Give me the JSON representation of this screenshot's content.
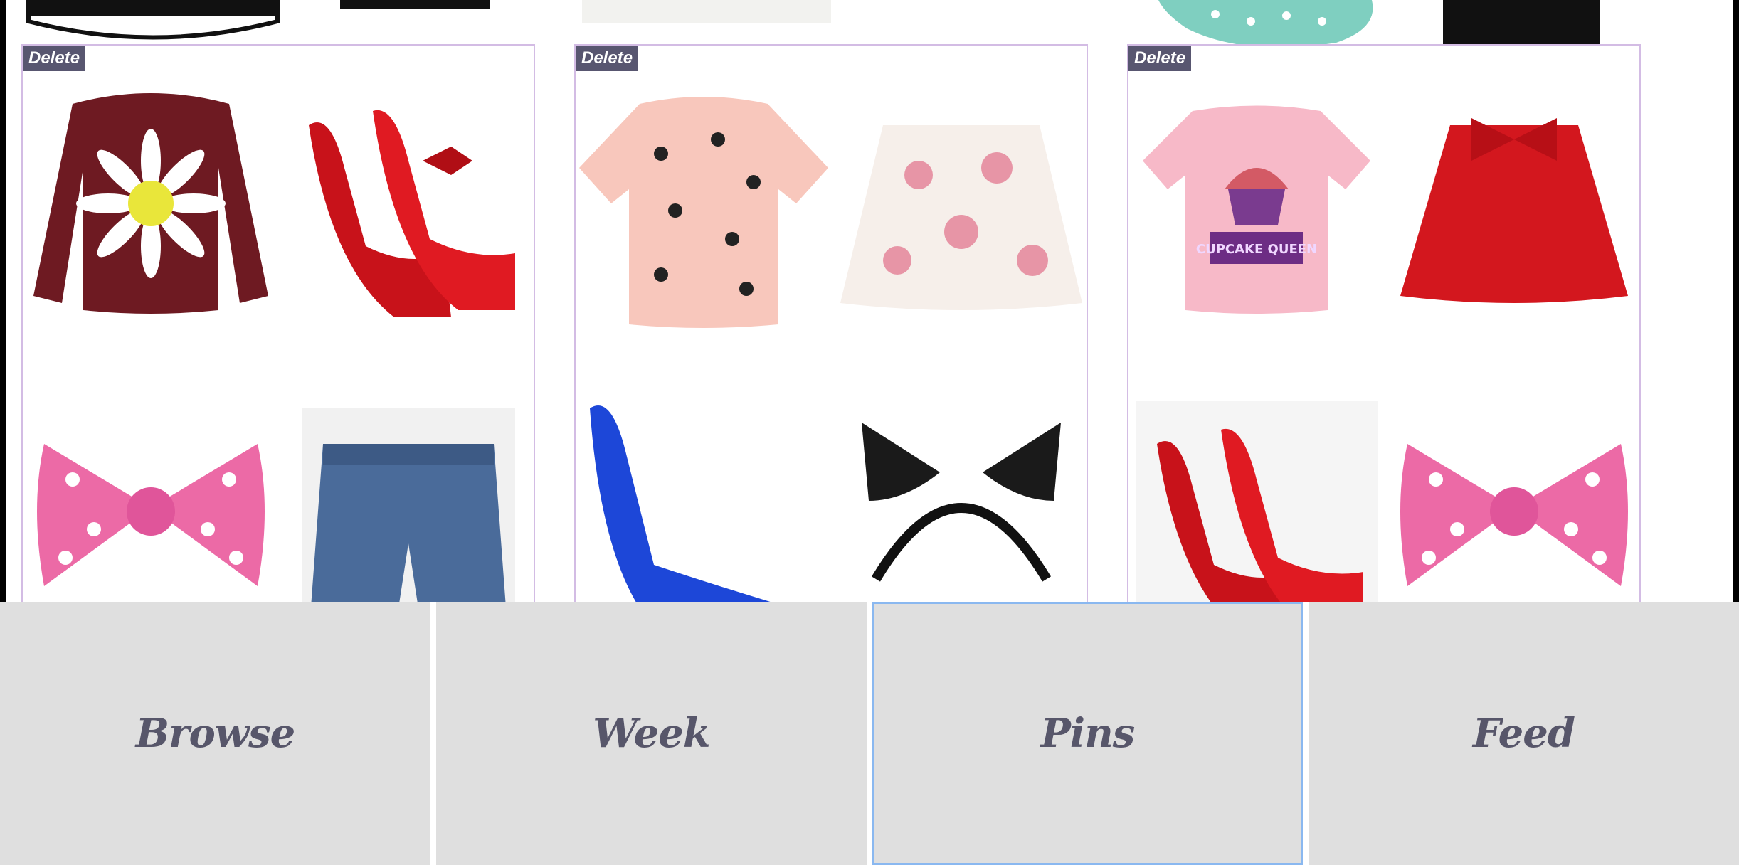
{
  "cards": [
    {
      "delete_label": "Delete"
    },
    {
      "delete_label": "Delete"
    },
    {
      "delete_label": "Delete"
    }
  ],
  "nav": {
    "items": [
      {
        "label": "Browse"
      },
      {
        "label": "Week"
      },
      {
        "label": "Pins"
      },
      {
        "label": "Feed"
      }
    ],
    "active": "Pins"
  },
  "cupcake_shirt_text": "CUPCAKE QUEEN",
  "colors": {
    "delete_bg": "#585670",
    "card_border": "#d3bce4",
    "nav_bg": "#dfdfdf",
    "nav_text": "#57566a",
    "active_outline": "#8ab8f0"
  }
}
